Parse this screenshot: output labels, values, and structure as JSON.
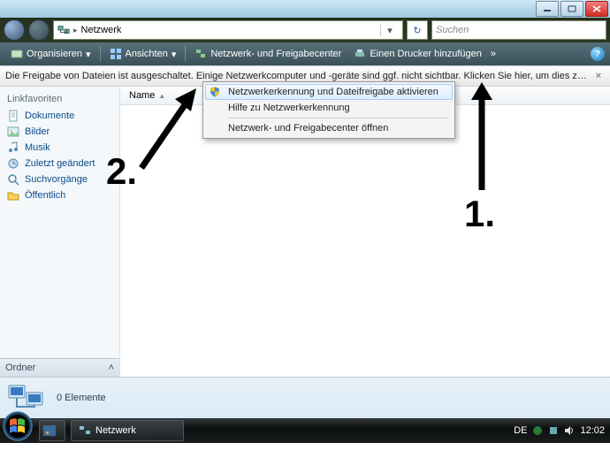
{
  "address": {
    "location": "Netzwerk"
  },
  "search": {
    "placeholder": "Suchen"
  },
  "commands": {
    "organize": "Organisieren",
    "views": "Ansichten",
    "netcenter": "Netzwerk- und Freigabecenter",
    "addprinter": "Einen Drucker hinzufügen"
  },
  "infobar": {
    "message": "Die Freigabe von Dateien ist ausgeschaltet. Einige Netzwerkcomputer und -geräte sind ggf. nicht sichtbar. Klicken Sie hier, um dies zu ändern..."
  },
  "sidebar": {
    "caption": "Linkfavoriten",
    "items": [
      {
        "label": "Dokumente"
      },
      {
        "label": "Bilder"
      },
      {
        "label": "Musik"
      },
      {
        "label": "Zuletzt geändert"
      },
      {
        "label": "Suchvorgänge"
      },
      {
        "label": "Öffentlich"
      }
    ],
    "folders": "Ordner"
  },
  "columns": {
    "name": "Name"
  },
  "contextmenu": {
    "item1": "Netzwerkerkennung und Dateifreigabe aktivieren",
    "item2": "Hilfe zu Netzwerkerkennung",
    "item3": "Netzwerk- und Freigabecenter öffnen"
  },
  "details": {
    "count": "0 Elemente"
  },
  "taskbar": {
    "app": "Netzwerk",
    "lang": "DE",
    "time": "12:02"
  },
  "annotations": {
    "one": "1.",
    "two": "2."
  }
}
